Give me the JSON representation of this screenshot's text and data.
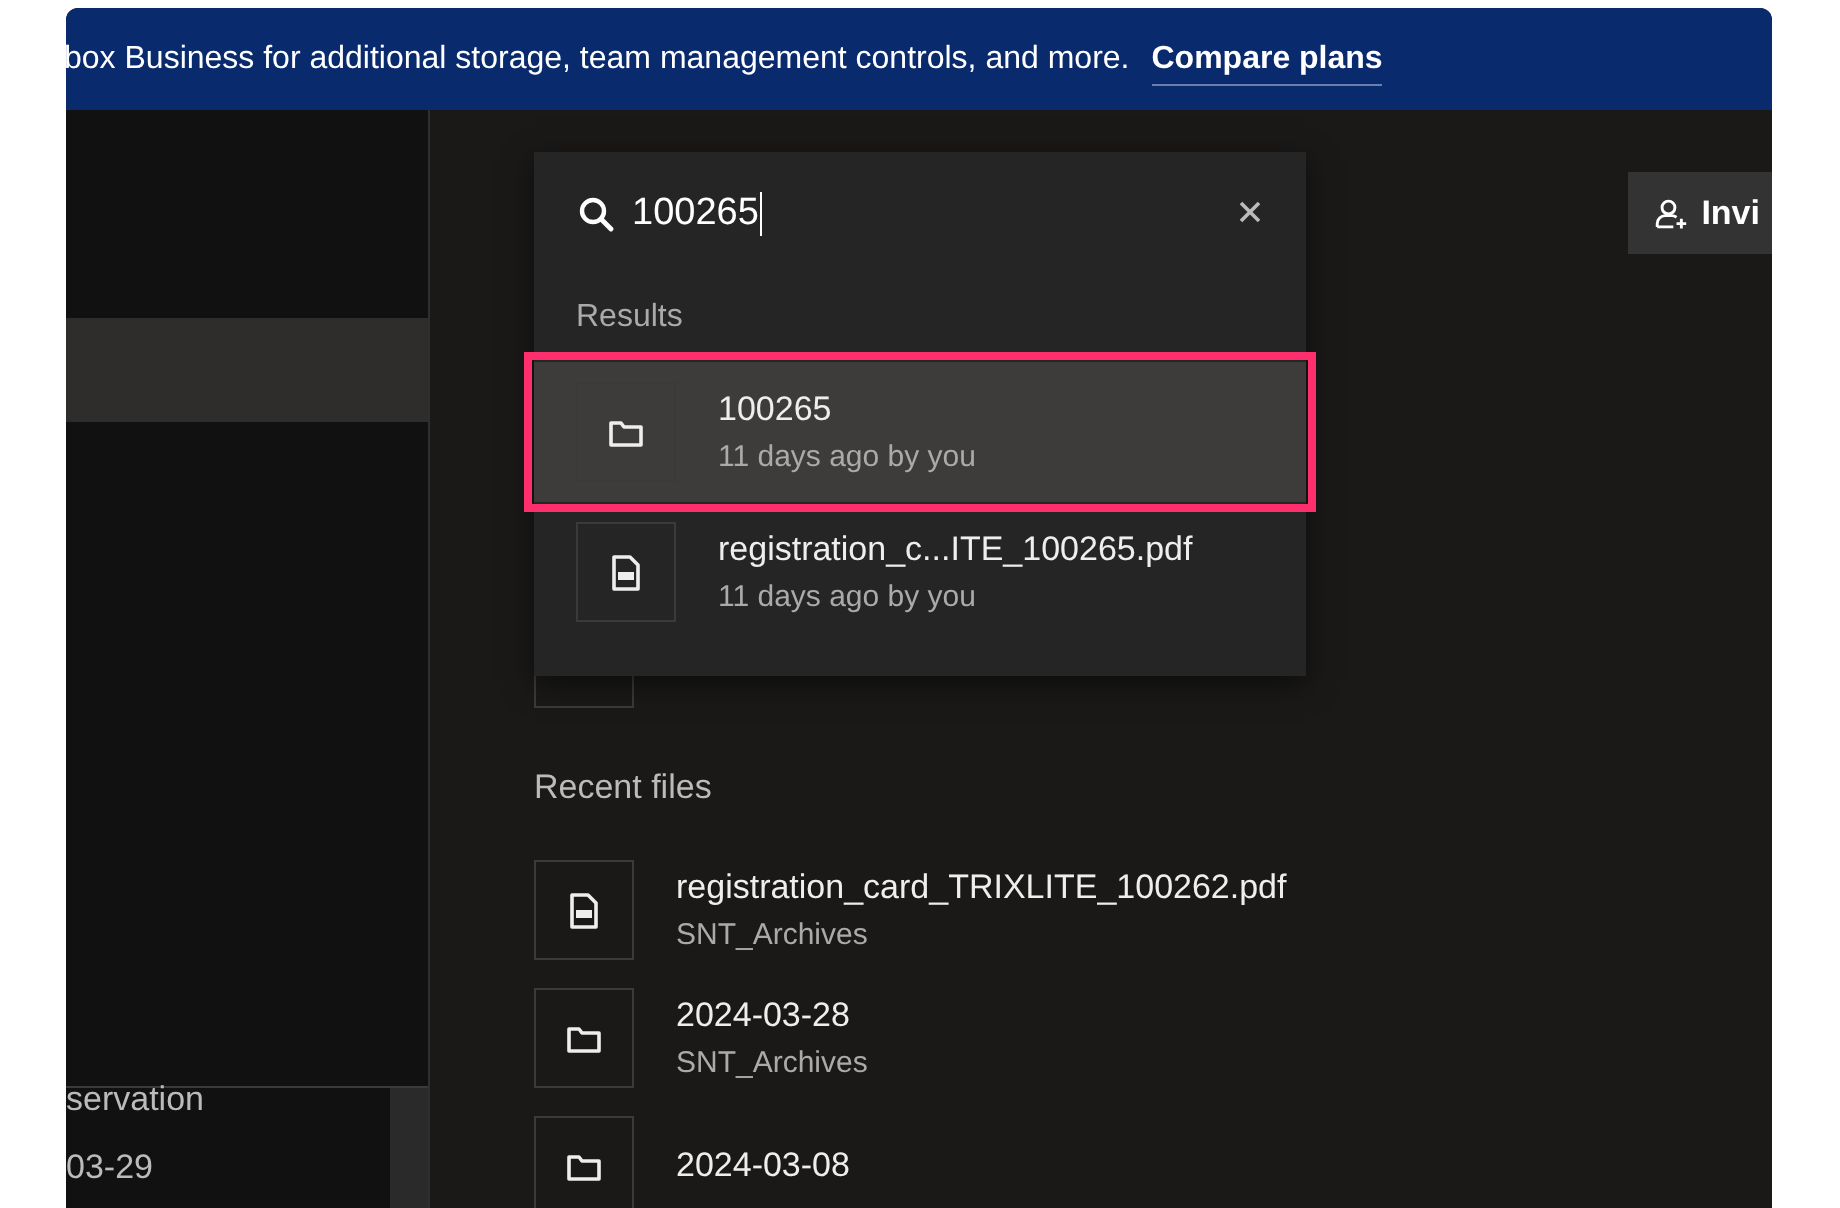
{
  "banner": {
    "text": "box Business for additional storage, team management controls, and more.",
    "link": "Compare plans"
  },
  "sidebar": {
    "items": [
      {
        "selected": true
      }
    ],
    "bottom_items": [
      "servation",
      "03-29"
    ]
  },
  "search": {
    "value": "100265",
    "results_heading": "Results",
    "results": [
      {
        "kind": "folder",
        "name": "100265",
        "meta": "11 days ago by you",
        "selected": true
      },
      {
        "kind": "pdf",
        "name": "registration_c...ITE_100265.pdf",
        "meta": "11 days ago by you",
        "selected": false
      }
    ]
  },
  "invite_button": "Invi",
  "recent": {
    "heading": "Recent files",
    "files": [
      {
        "kind": "pdf",
        "name": "registration_card_TRIXLITE_100262.pdf",
        "location": "SNT_Archives"
      },
      {
        "kind": "folder",
        "name": "2024-03-28",
        "location": "SNT_Archives"
      },
      {
        "kind": "folder",
        "name": "2024-03-08"
      }
    ]
  }
}
